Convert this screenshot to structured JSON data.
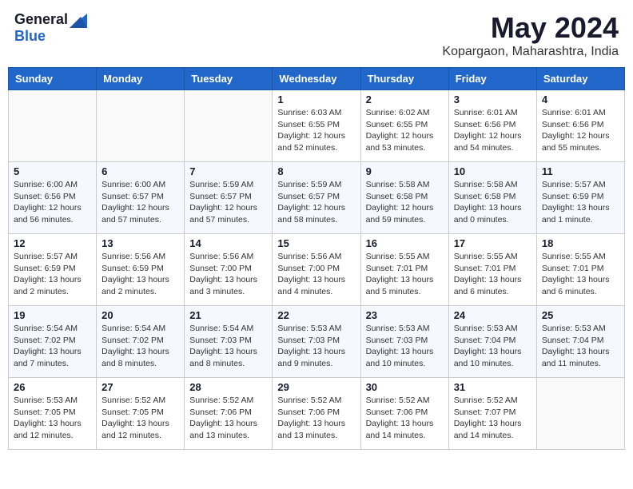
{
  "header": {
    "logo_general": "General",
    "logo_blue": "Blue",
    "month": "May 2024",
    "location": "Kopargaon, Maharashtra, India"
  },
  "weekdays": [
    "Sunday",
    "Monday",
    "Tuesday",
    "Wednesday",
    "Thursday",
    "Friday",
    "Saturday"
  ],
  "weeks": [
    [
      {
        "day": "",
        "info": ""
      },
      {
        "day": "",
        "info": ""
      },
      {
        "day": "",
        "info": ""
      },
      {
        "day": "1",
        "info": "Sunrise: 6:03 AM\nSunset: 6:55 PM\nDaylight: 12 hours\nand 52 minutes."
      },
      {
        "day": "2",
        "info": "Sunrise: 6:02 AM\nSunset: 6:55 PM\nDaylight: 12 hours\nand 53 minutes."
      },
      {
        "day": "3",
        "info": "Sunrise: 6:01 AM\nSunset: 6:56 PM\nDaylight: 12 hours\nand 54 minutes."
      },
      {
        "day": "4",
        "info": "Sunrise: 6:01 AM\nSunset: 6:56 PM\nDaylight: 12 hours\nand 55 minutes."
      }
    ],
    [
      {
        "day": "5",
        "info": "Sunrise: 6:00 AM\nSunset: 6:56 PM\nDaylight: 12 hours\nand 56 minutes."
      },
      {
        "day": "6",
        "info": "Sunrise: 6:00 AM\nSunset: 6:57 PM\nDaylight: 12 hours\nand 57 minutes."
      },
      {
        "day": "7",
        "info": "Sunrise: 5:59 AM\nSunset: 6:57 PM\nDaylight: 12 hours\nand 57 minutes."
      },
      {
        "day": "8",
        "info": "Sunrise: 5:59 AM\nSunset: 6:57 PM\nDaylight: 12 hours\nand 58 minutes."
      },
      {
        "day": "9",
        "info": "Sunrise: 5:58 AM\nSunset: 6:58 PM\nDaylight: 12 hours\nand 59 minutes."
      },
      {
        "day": "10",
        "info": "Sunrise: 5:58 AM\nSunset: 6:58 PM\nDaylight: 13 hours\nand 0 minutes."
      },
      {
        "day": "11",
        "info": "Sunrise: 5:57 AM\nSunset: 6:59 PM\nDaylight: 13 hours\nand 1 minute."
      }
    ],
    [
      {
        "day": "12",
        "info": "Sunrise: 5:57 AM\nSunset: 6:59 PM\nDaylight: 13 hours\nand 2 minutes."
      },
      {
        "day": "13",
        "info": "Sunrise: 5:56 AM\nSunset: 6:59 PM\nDaylight: 13 hours\nand 2 minutes."
      },
      {
        "day": "14",
        "info": "Sunrise: 5:56 AM\nSunset: 7:00 PM\nDaylight: 13 hours\nand 3 minutes."
      },
      {
        "day": "15",
        "info": "Sunrise: 5:56 AM\nSunset: 7:00 PM\nDaylight: 13 hours\nand 4 minutes."
      },
      {
        "day": "16",
        "info": "Sunrise: 5:55 AM\nSunset: 7:01 PM\nDaylight: 13 hours\nand 5 minutes."
      },
      {
        "day": "17",
        "info": "Sunrise: 5:55 AM\nSunset: 7:01 PM\nDaylight: 13 hours\nand 6 minutes."
      },
      {
        "day": "18",
        "info": "Sunrise: 5:55 AM\nSunset: 7:01 PM\nDaylight: 13 hours\nand 6 minutes."
      }
    ],
    [
      {
        "day": "19",
        "info": "Sunrise: 5:54 AM\nSunset: 7:02 PM\nDaylight: 13 hours\nand 7 minutes."
      },
      {
        "day": "20",
        "info": "Sunrise: 5:54 AM\nSunset: 7:02 PM\nDaylight: 13 hours\nand 8 minutes."
      },
      {
        "day": "21",
        "info": "Sunrise: 5:54 AM\nSunset: 7:03 PM\nDaylight: 13 hours\nand 8 minutes."
      },
      {
        "day": "22",
        "info": "Sunrise: 5:53 AM\nSunset: 7:03 PM\nDaylight: 13 hours\nand 9 minutes."
      },
      {
        "day": "23",
        "info": "Sunrise: 5:53 AM\nSunset: 7:03 PM\nDaylight: 13 hours\nand 10 minutes."
      },
      {
        "day": "24",
        "info": "Sunrise: 5:53 AM\nSunset: 7:04 PM\nDaylight: 13 hours\nand 10 minutes."
      },
      {
        "day": "25",
        "info": "Sunrise: 5:53 AM\nSunset: 7:04 PM\nDaylight: 13 hours\nand 11 minutes."
      }
    ],
    [
      {
        "day": "26",
        "info": "Sunrise: 5:53 AM\nSunset: 7:05 PM\nDaylight: 13 hours\nand 12 minutes."
      },
      {
        "day": "27",
        "info": "Sunrise: 5:52 AM\nSunset: 7:05 PM\nDaylight: 13 hours\nand 12 minutes."
      },
      {
        "day": "28",
        "info": "Sunrise: 5:52 AM\nSunset: 7:06 PM\nDaylight: 13 hours\nand 13 minutes."
      },
      {
        "day": "29",
        "info": "Sunrise: 5:52 AM\nSunset: 7:06 PM\nDaylight: 13 hours\nand 13 minutes."
      },
      {
        "day": "30",
        "info": "Sunrise: 5:52 AM\nSunset: 7:06 PM\nDaylight: 13 hours\nand 14 minutes."
      },
      {
        "day": "31",
        "info": "Sunrise: 5:52 AM\nSunset: 7:07 PM\nDaylight: 13 hours\nand 14 minutes."
      },
      {
        "day": "",
        "info": ""
      }
    ]
  ]
}
